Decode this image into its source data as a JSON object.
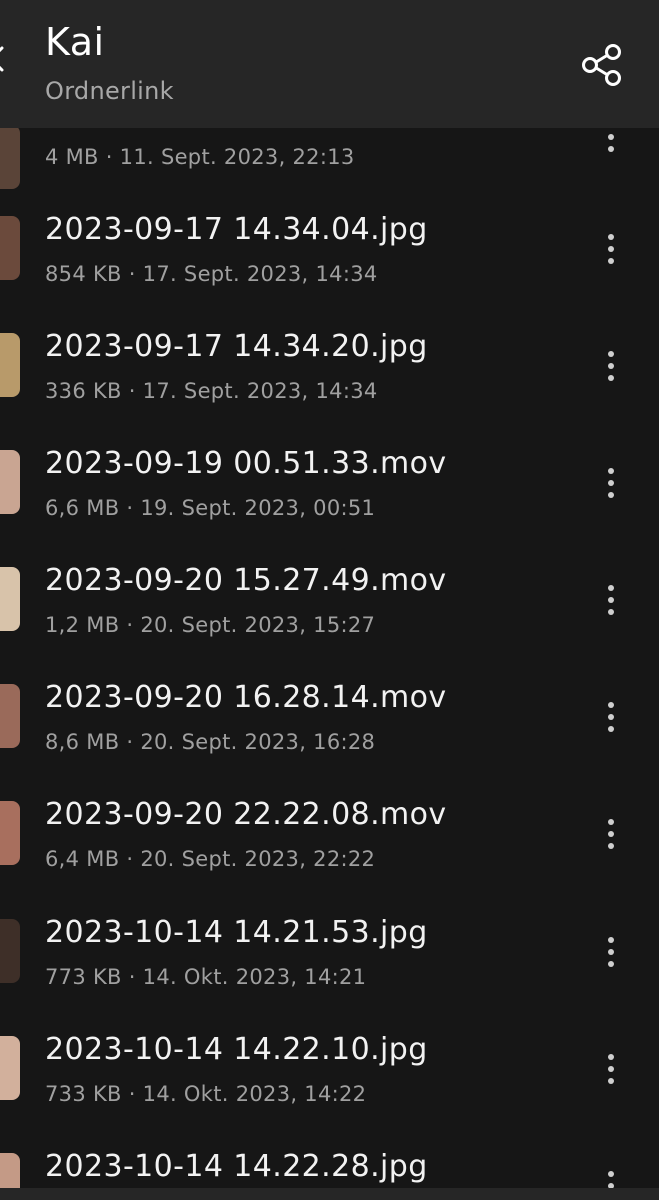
{
  "header": {
    "title": "Kai",
    "subtitle": "Ordnerlink",
    "back_icon": "back-arrow-icon",
    "share_icon": "share-icon"
  },
  "files": [
    {
      "name": "",
      "meta": "4 MB · 11. Sept. 2023, 22:13",
      "thumb_color": "#5a4438"
    },
    {
      "name": "2023-09-17 14.34.04.jpg",
      "meta": "854 KB · 17. Sept. 2023, 14:34",
      "thumb_color": "#6b4a3c"
    },
    {
      "name": "2023-09-17 14.34.20.jpg",
      "meta": "336 KB · 17. Sept. 2023, 14:34",
      "thumb_color": "#b89a6a"
    },
    {
      "name": "2023-09-19 00.51.33.mov",
      "meta": "6,6 MB · 19. Sept. 2023, 00:51",
      "thumb_color": "#c9a592"
    },
    {
      "name": "2023-09-20 15.27.49.mov",
      "meta": "1,2 MB · 20. Sept. 2023, 15:27",
      "thumb_color": "#d8c3aa"
    },
    {
      "name": "2023-09-20 16.28.14.mov",
      "meta": "8,6 MB · 20. Sept. 2023, 16:28",
      "thumb_color": "#9a6a5a"
    },
    {
      "name": "2023-09-20 22.22.08.mov",
      "meta": "6,4 MB · 20. Sept. 2023, 22:22",
      "thumb_color": "#a86f5e"
    },
    {
      "name": "2023-10-14 14.21.53.jpg",
      "meta": "773 KB · 14. Okt. 2023, 14:21",
      "thumb_color": "#3e2f28"
    },
    {
      "name": "2023-10-14 14.22.10.jpg",
      "meta": "733 KB · 14. Okt. 2023, 14:22",
      "thumb_color": "#d2b09c"
    },
    {
      "name": "2023-10-14 14.22.28.jpg",
      "meta": "",
      "thumb_color": "#c49a86"
    }
  ],
  "row_icon": "more-vertical-icon",
  "colors": {
    "background": "#161616",
    "header": "#262626",
    "primary_text": "#f2f2f2",
    "secondary_text": "#a0a0a0"
  }
}
